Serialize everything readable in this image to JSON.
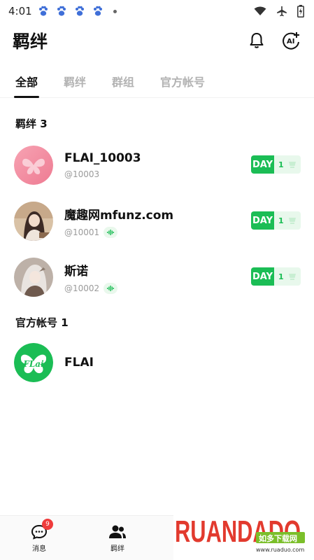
{
  "status_bar": {
    "time": "4:01",
    "notification_icons": [
      "paw-icon",
      "paw-icon",
      "paw-icon",
      "paw-icon"
    ],
    "indicators": [
      "wifi-icon",
      "airplane-icon",
      "battery-icon"
    ]
  },
  "header": {
    "title": "羁绊",
    "actions": [
      "bell-icon",
      "ai-add-icon"
    ],
    "ai_icon_text": "AI"
  },
  "tabs": [
    {
      "label": "全部",
      "active": true
    },
    {
      "label": "羁绊",
      "active": false
    },
    {
      "label": "群组",
      "active": false
    },
    {
      "label": "官方帐号",
      "active": false
    }
  ],
  "sections": {
    "bonds": {
      "header": "羁绊 3",
      "items": [
        {
          "name": "FLAI_10003",
          "id": "@10003",
          "voice": false,
          "badge_label": "DAY",
          "badge_value": "1"
        },
        {
          "name": "魔趣网mfunz.com",
          "id": "@10001",
          "voice": true,
          "badge_label": "DAY",
          "badge_value": "1"
        },
        {
          "name": "斯诺",
          "id": "@10002",
          "voice": true,
          "badge_label": "DAY",
          "badge_value": "1"
        }
      ]
    },
    "official": {
      "header": "官方帐号 1",
      "items": [
        {
          "name": "FLAI",
          "logo_text": "FLai"
        }
      ]
    }
  },
  "bottom_nav": {
    "items": [
      {
        "label": "消息",
        "icon": "chat-icon",
        "badge": "9"
      },
      {
        "label": "羁绊",
        "icon": "users-icon"
      }
    ]
  },
  "watermark": {
    "brand": "RUANDADO",
    "tagline": "如多下载网",
    "url": "www.ruaduo.com"
  },
  "colors": {
    "accent_green": "#1bbd55",
    "badge_red": "#ef3b3b",
    "tab_inactive": "#b3b3b3"
  }
}
